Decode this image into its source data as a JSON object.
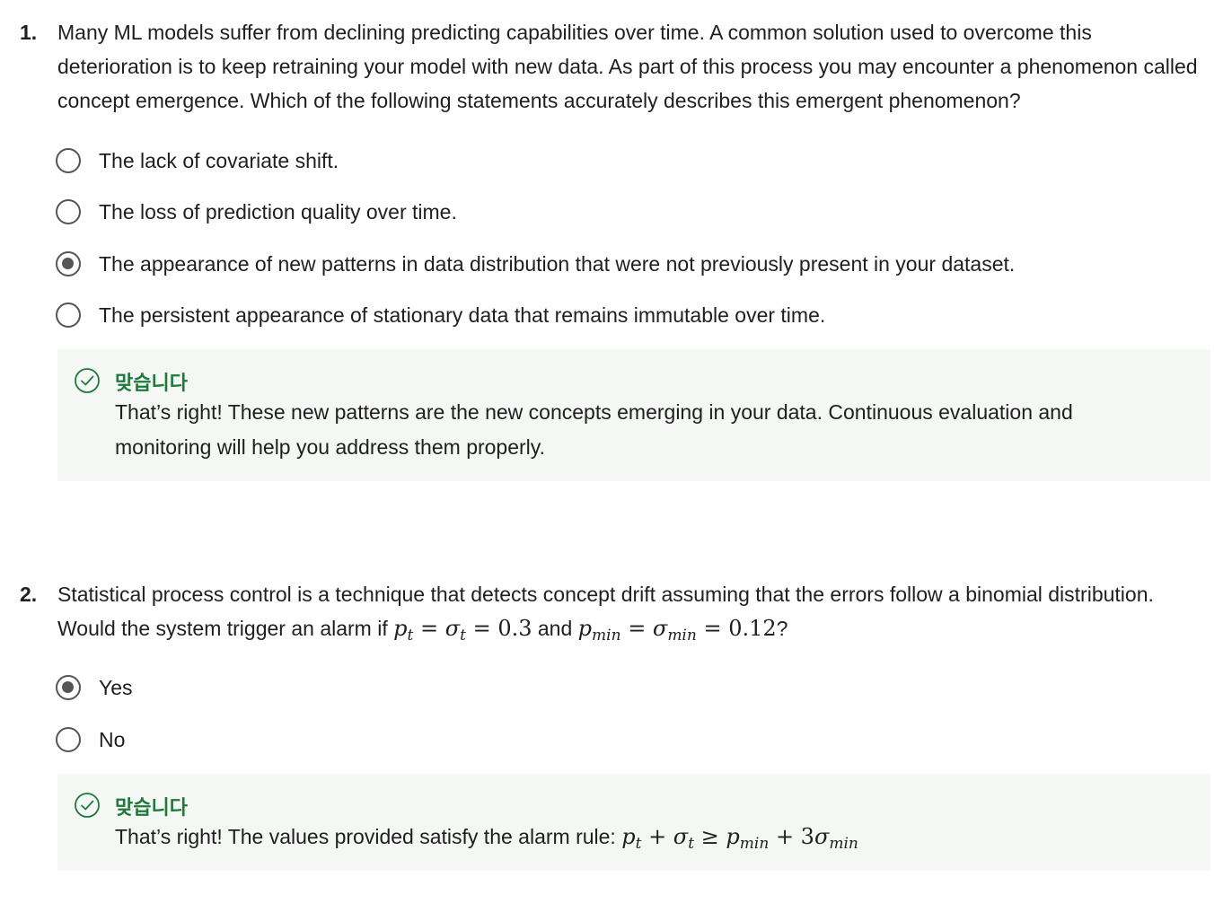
{
  "questions": [
    {
      "number": "1.",
      "text": "Many ML models suffer from declining predicting capabilities over time. A common solution used to overcome this deterioration is to keep retraining your model with new data. As part of this process you may encounter a phenomenon called concept emergence. Which of the following statements accurately describes this emergent phenomenon?",
      "options": [
        {
          "label": "The lack of covariate shift.",
          "selected": false
        },
        {
          "label": "The loss of prediction quality over time.",
          "selected": false
        },
        {
          "label": "The appearance of new patterns in data distribution that were not previously present in your dataset.",
          "selected": true
        },
        {
          "label": "The persistent appearance of stationary data that remains immutable over time.",
          "selected": false
        }
      ],
      "feedback": {
        "status": "맞습니다",
        "text": "That’s right! These new patterns are the new concepts emerging in your data. Continuous evaluation and monitoring will help you address them properly."
      }
    },
    {
      "number": "2.",
      "text_before": "Statistical process control is a technique that detects concept drift assuming that the errors follow a binomial distribution. Would the system trigger an alarm if",
      "text_and": "and",
      "text_end": "?",
      "options": [
        {
          "label": "Yes",
          "selected": true
        },
        {
          "label": "No",
          "selected": false
        }
      ],
      "feedback": {
        "status": "맞습니다",
        "text": "That’s right! The values provided satisfy the alarm rule:"
      }
    }
  ],
  "colors": {
    "success": "#1e7a3c",
    "feedback_bg": "#f4f7f4",
    "radio": "#555555"
  },
  "icons": {
    "feedback": "check-circle-icon"
  }
}
